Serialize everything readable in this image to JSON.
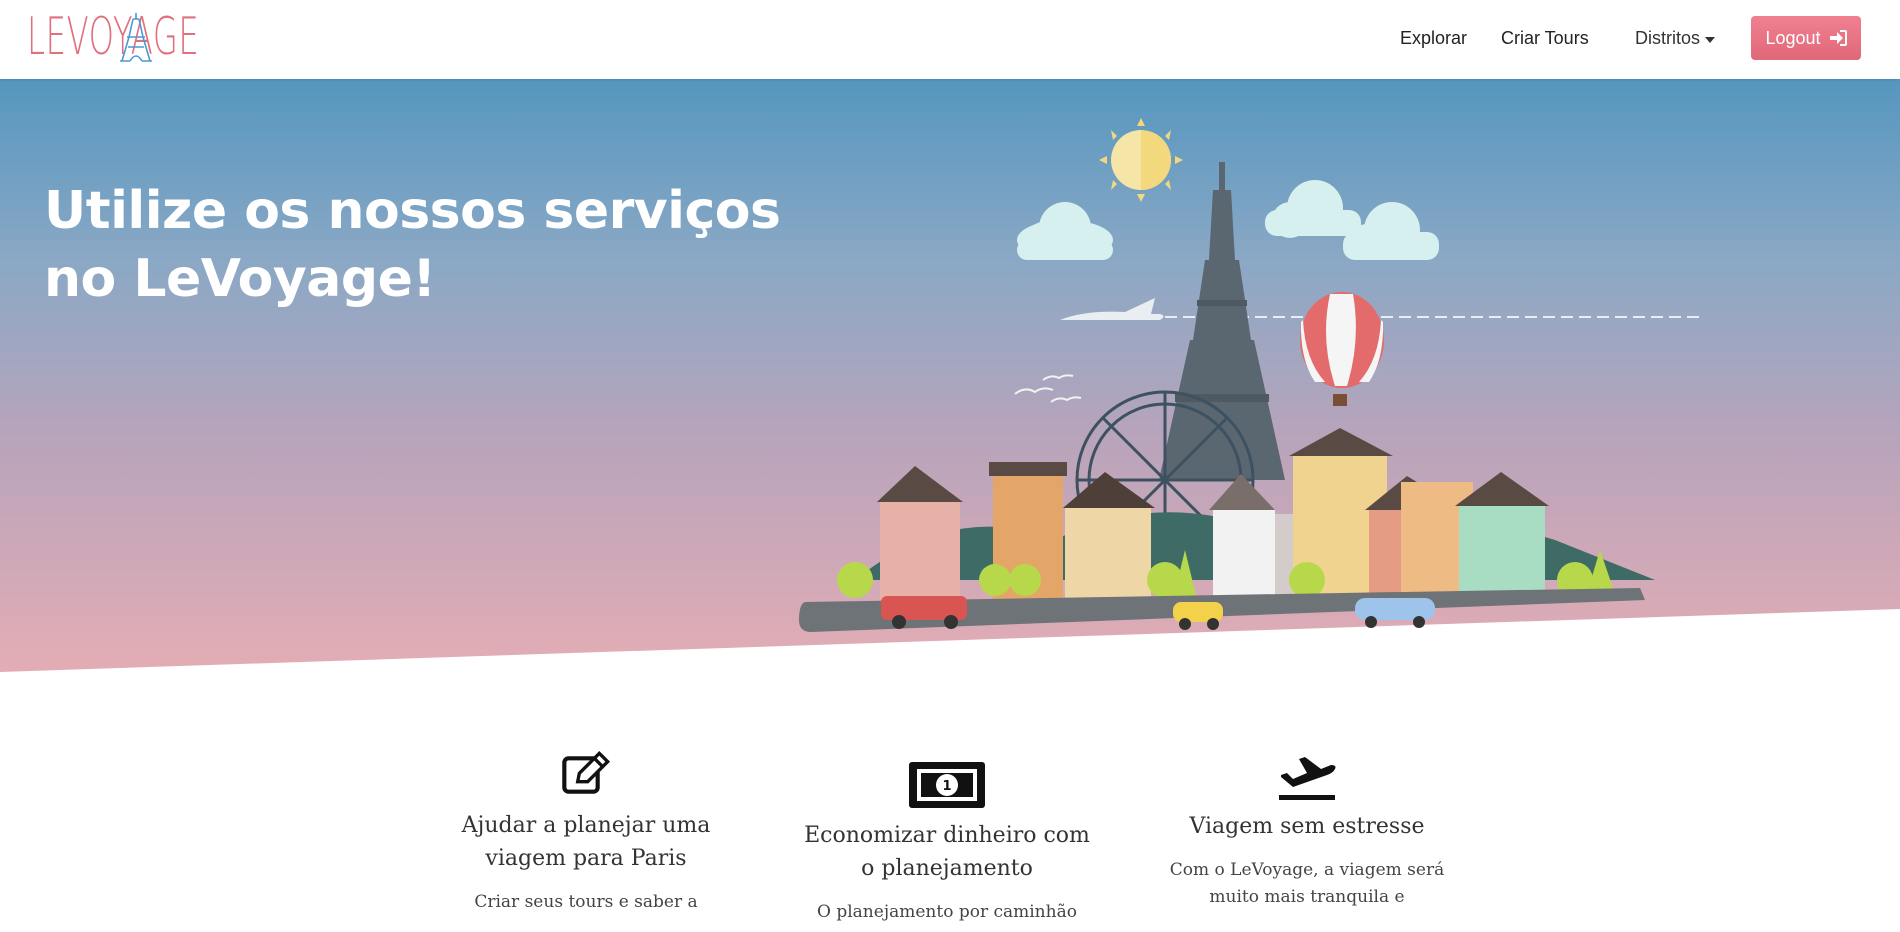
{
  "brand": {
    "logo_text": "LEVOYAGE"
  },
  "nav": {
    "explore_label": "Explorar",
    "create_tours_label": "Criar Tours",
    "districts_label": "Distritos",
    "logout_label": "Logout"
  },
  "hero": {
    "title": "Utilize os nossos serviços no LeVoyage!"
  },
  "features": [
    {
      "icon": "edit-icon",
      "title": "Ajudar a planejar uma viagem para Paris",
      "description": "Criar seus tours e saber a"
    },
    {
      "icon": "money-bill-icon",
      "title": "Economizar dinheiro com o planejamento",
      "description": "O planejamento por caminhão"
    },
    {
      "icon": "plane-departure-icon",
      "title": "Viagem sem estresse",
      "description": "Com o LeVoyage, a viagem será muito mais tranquila e"
    }
  ],
  "colors": {
    "brand_pink": "#e0707c",
    "hero_top": "#5596bf",
    "hero_bottom": "#e5adb4"
  }
}
